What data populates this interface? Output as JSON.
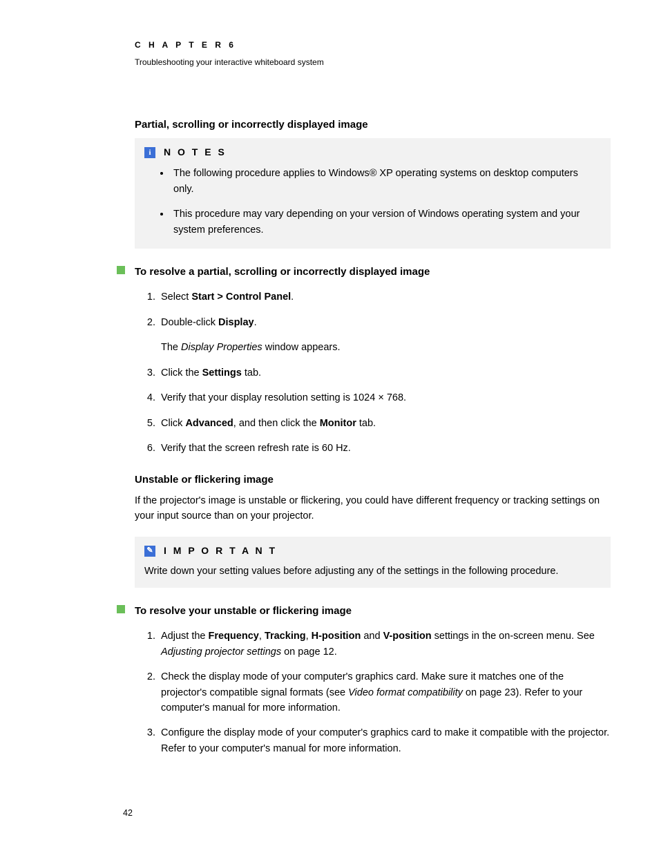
{
  "header": {
    "chapter_label": "C H A P T E R   6",
    "chapter_subtitle": "Troubleshooting your interactive whiteboard system"
  },
  "section1": {
    "heading": "Partial, scrolling or incorrectly displayed image"
  },
  "notes_callout": {
    "title": "N O T E S",
    "icon_glyph": "i",
    "items": [
      "The following procedure applies to Windows® XP operating systems on desktop computers only.",
      "This procedure may vary depending on your version of Windows operating system and your system preferences."
    ]
  },
  "procedure1": {
    "title": "To resolve a partial, scrolling or incorrectly displayed image",
    "steps": {
      "s1_pre": "Select ",
      "s1_bold": "Start > Control Panel",
      "s1_post": ".",
      "s2_pre": "Double-click ",
      "s2_bold": "Display",
      "s2_post": ".",
      "s2_sub_pre": "The ",
      "s2_sub_italic": "Display Properties",
      "s2_sub_post": " window appears.",
      "s3_pre": "Click the ",
      "s3_bold": "Settings",
      "s3_post": " tab.",
      "s4": "Verify that your display resolution setting is 1024 × 768.",
      "s5_pre": "Click ",
      "s5_bold1": "Advanced",
      "s5_mid": ", and then click the ",
      "s5_bold2": "Monitor",
      "s5_post": " tab.",
      "s6": "Verify that the screen refresh rate is 60 Hz."
    }
  },
  "section2": {
    "heading": "Unstable or flickering image",
    "body": "If the projector's image is unstable or flickering, you could have different frequency or tracking settings on your input source than on your projector."
  },
  "important_callout": {
    "title": "I M P O R T A N T",
    "icon_glyph": "✎",
    "body": "Write down your setting values before adjusting any of the settings in the following procedure."
  },
  "procedure2": {
    "title": "To resolve your unstable or flickering image",
    "steps": {
      "s1_pre": "Adjust the ",
      "s1_b1": "Frequency",
      "s1_c1": ", ",
      "s1_b2": "Tracking",
      "s1_c2": ", ",
      "s1_b3": "H-position",
      "s1_c3": " and ",
      "s1_b4": "V-position",
      "s1_post": " settings in the on-screen menu. See ",
      "s1_italic": "Adjusting projector settings",
      "s1_tail": " on page 12.",
      "s2_pre": "Check the display mode of your computer's graphics card. Make sure it matches one of the projector's compatible signal formats (see ",
      "s2_italic": "Video format compatibility",
      "s2_post": " on page 23). Refer to your computer's manual for more information.",
      "s3": "Configure the display mode of your computer's graphics card to make it compatible with the projector. Refer to your computer's manual for more information."
    }
  },
  "page_number": "42"
}
